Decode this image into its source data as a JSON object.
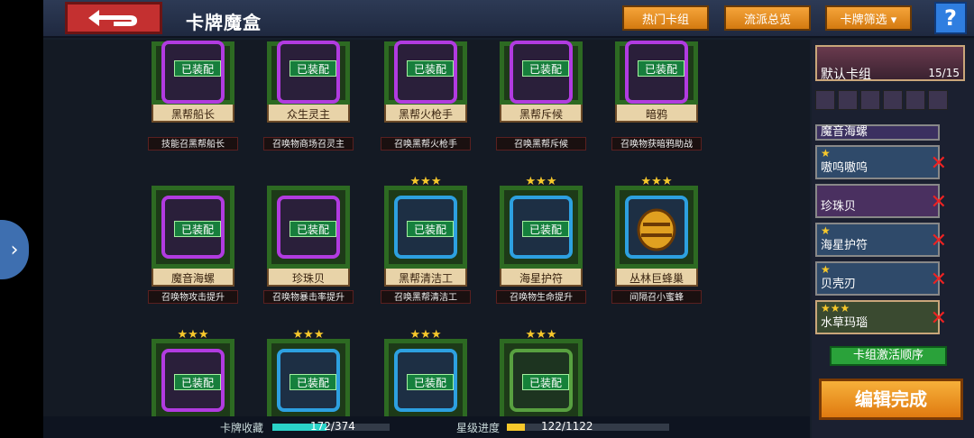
{
  "header": {
    "title": "卡牌魔盒",
    "buttons": [
      "热门卡组",
      "流派总览",
      "卡牌筛选 ▾"
    ],
    "help": "?"
  },
  "cards": [
    {
      "name": "黑帮船长",
      "effect": "技能召黑帮船长",
      "equipped": "已装配",
      "stars": "",
      "frame": "purple"
    },
    {
      "name": "众生灵主",
      "effect": "召唤物商场召灵主",
      "equipped": "已装配",
      "stars": "",
      "frame": "purple"
    },
    {
      "name": "黑帮火枪手",
      "effect": "召唤黑帮火枪手",
      "equipped": "已装配",
      "stars": "",
      "frame": "purple"
    },
    {
      "name": "黑帮斥候",
      "effect": "召唤黑帮斥候",
      "equipped": "已装配",
      "stars": "",
      "frame": "purple"
    },
    {
      "name": "暗鸦",
      "effect": "召唤物获暗鸦助战",
      "equipped": "已装配",
      "stars": "",
      "frame": "purple"
    },
    {
      "name": "魔音海螺",
      "effect": "召唤物攻击提升",
      "equipped": "已装配",
      "stars": "",
      "frame": "purple"
    },
    {
      "name": "珍珠贝",
      "effect": "召唤物暴击率提升",
      "equipped": "已装配",
      "stars": "",
      "frame": "purple"
    },
    {
      "name": "黑帮清洁工",
      "effect": "召唤黑帮清洁工",
      "equipped": "已装配",
      "stars": "★★★",
      "frame": "blue"
    },
    {
      "name": "海星护符",
      "effect": "召唤物生命提升",
      "equipped": "已装配",
      "stars": "★★★",
      "frame": "blue"
    },
    {
      "name": "丛林巨蜂巢",
      "effect": "间隔召小蜜蜂",
      "equipped": "",
      "stars": "★★★",
      "frame": "blue"
    },
    {
      "name": "",
      "effect": "",
      "equipped": "已装配",
      "stars": "★★★",
      "frame": "purple"
    },
    {
      "name": "",
      "effect": "",
      "equipped": "已装配",
      "stars": "★★★",
      "frame": "blue"
    },
    {
      "name": "",
      "effect": "",
      "equipped": "已装配",
      "stars": "★★★",
      "frame": "blue"
    },
    {
      "name": "",
      "effect": "",
      "equipped": "已装配",
      "stars": "★★★",
      "frame": "green"
    }
  ],
  "footer": {
    "collection_label": "卡牌收藏",
    "collection_value": "172/374",
    "collection_progress": 0.46,
    "star_label": "星级进度",
    "star_value": "122/1122",
    "star_progress": 0.11
  },
  "panel": {
    "deck_name": "默认卡组",
    "deck_count": "15/15",
    "rows": [
      {
        "name": "魔音海螺",
        "stars": ""
      },
      {
        "name": "嗷呜嗷呜",
        "stars": "★"
      },
      {
        "name": "珍珠贝",
        "stars": ""
      },
      {
        "name": "海星护符",
        "stars": "★"
      },
      {
        "name": "贝壳刃",
        "stars": "★"
      },
      {
        "name": "水草玛瑙",
        "stars": "★★★"
      }
    ],
    "activate_label": "卡组激活顺序",
    "finish_label": "编辑完成"
  },
  "colors": {
    "accent": "#f5a43a",
    "equipped": "#148c3c",
    "panel": "#1b2030"
  }
}
